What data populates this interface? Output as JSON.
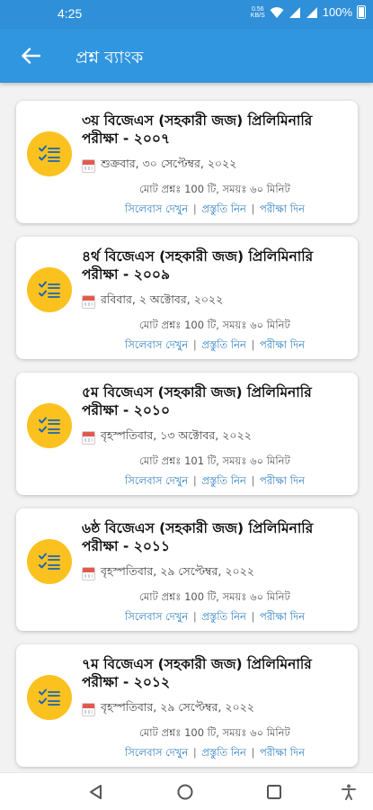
{
  "status_bar": {
    "time": "4:25",
    "net_speed_top": "0.56",
    "net_speed_bottom": "KB/S",
    "battery": "100%"
  },
  "app_bar": {
    "title": "প্রশ্ন ব্যাংক",
    "color": "#3196e0"
  },
  "cards": [
    {
      "title": "৩য় বিজেএস (সহকারী জজ) প্রিলিমিনারি পরীক্ষা - ২০০৭",
      "date": "শুক্রবার, ৩০ সেপ্টেম্বর, ২০২২",
      "meta": "মোট প্রশ্নঃ 100 টি, সময়ঃ ৬০ মিনিট",
      "syllabus": "সিলেবাস দেখুন",
      "prepare": "প্রস্তুতি নিন",
      "exam": "পরীক্ষা দিন"
    },
    {
      "title": "৪র্থ বিজেএস (সহকারী জজ) প্রিলিমিনারি পরীক্ষা - ২০০৯",
      "date": "রবিবার, ২ অক্টোবর, ২০২২",
      "meta": "মোট প্রশ্নঃ 100 টি, সময়ঃ ৬০ মিনিট",
      "syllabus": "সিলেবাস দেখুন",
      "prepare": "প্রস্তুতি নিন",
      "exam": "পরীক্ষা দিন"
    },
    {
      "title": "৫ম বিজেএস (সহকারী জজ) প্রিলিমিনারি পরীক্ষা - ২০১০",
      "date": "বৃহস্পতিবার, ১৩ অক্টোবর, ২০২২",
      "meta": "মোট প্রশ্নঃ 101 টি, সময়ঃ ৬০ মিনিট",
      "syllabus": "সিলেবাস দেখুন",
      "prepare": "প্রস্তুতি নিন",
      "exam": "পরীক্ষা দিন"
    },
    {
      "title": "৬ষ্ঠ বিজেএস (সহকারী জজ) প্রিলিমিনারি পরীক্ষা - ২০১১",
      "date": "বৃহস্পতিবার, ২৯ সেপ্টেম্বর, ২০২২",
      "meta": "মোট প্রশ্নঃ 100 টি, সময়ঃ ৬০ মিনিট",
      "syllabus": "সিলেবাস দেখুন",
      "prepare": "প্রস্তুতি নিন",
      "exam": "পরীক্ষা দিন"
    },
    {
      "title": "৭ম বিজেএস (সহকারী জজ) প্রিলিমিনারি পরীক্ষা - ২০১২",
      "date": "বৃহস্পতিবার, ২৯ সেপ্টেম্বর, ২০২২",
      "meta": "মোট প্রশ্নঃ 100 টি, সময়ঃ ৬০ মিনিট",
      "syllabus": "সিলেবাস দেখুন",
      "prepare": "প্রস্তুতি নিন",
      "exam": "পরীক্ষা দিন"
    }
  ],
  "icons": {
    "back": "arrow-back-icon",
    "card": "checklist-icon",
    "date": "calendar-icon",
    "nav": [
      "back-triangle-icon",
      "home-circle-icon",
      "recents-square-icon",
      "accessibility-icon"
    ]
  }
}
